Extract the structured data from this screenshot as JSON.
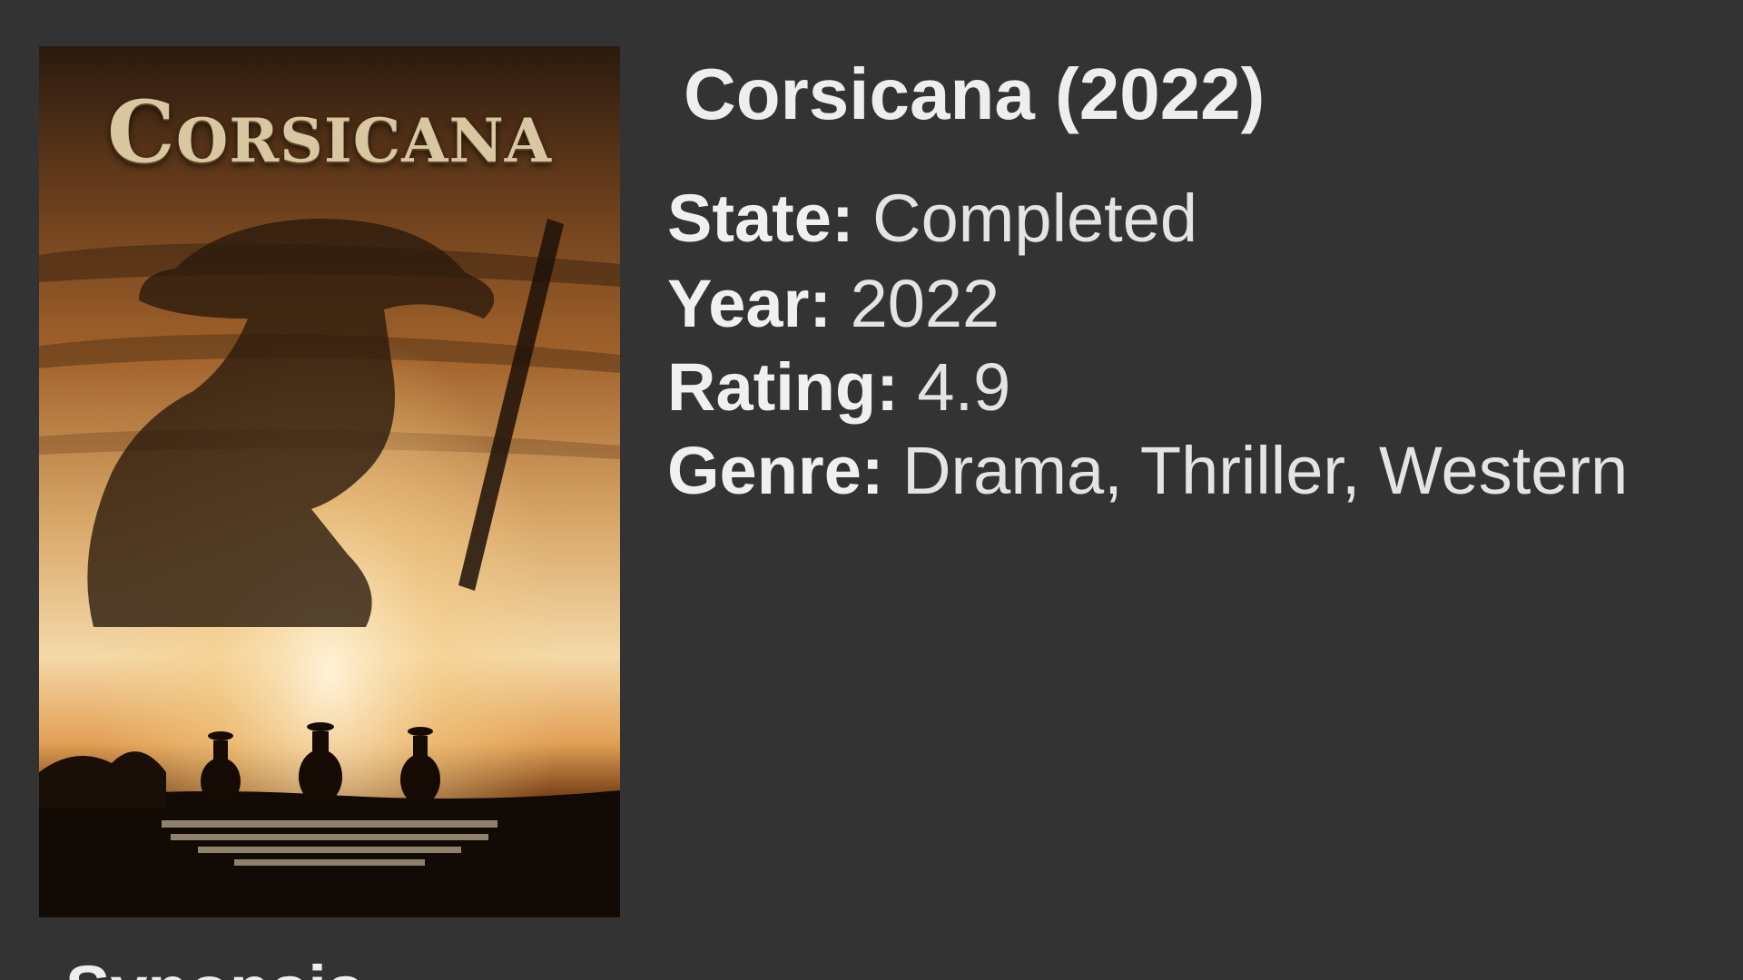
{
  "poster": {
    "title_text": "Corsicana"
  },
  "movie": {
    "title": "Corsicana (2022)",
    "state_label": "State:",
    "state_value": "Completed",
    "year_label": "Year:",
    "year_value": "2022",
    "rating_label": "Rating:",
    "rating_value": "4.9",
    "genre_label": "Genre:",
    "genre_value": "Drama, Thriller, Western"
  },
  "synopsis_heading": "Synopsis",
  "colors": {
    "background": "#333333",
    "text": "#e6e6e6"
  }
}
